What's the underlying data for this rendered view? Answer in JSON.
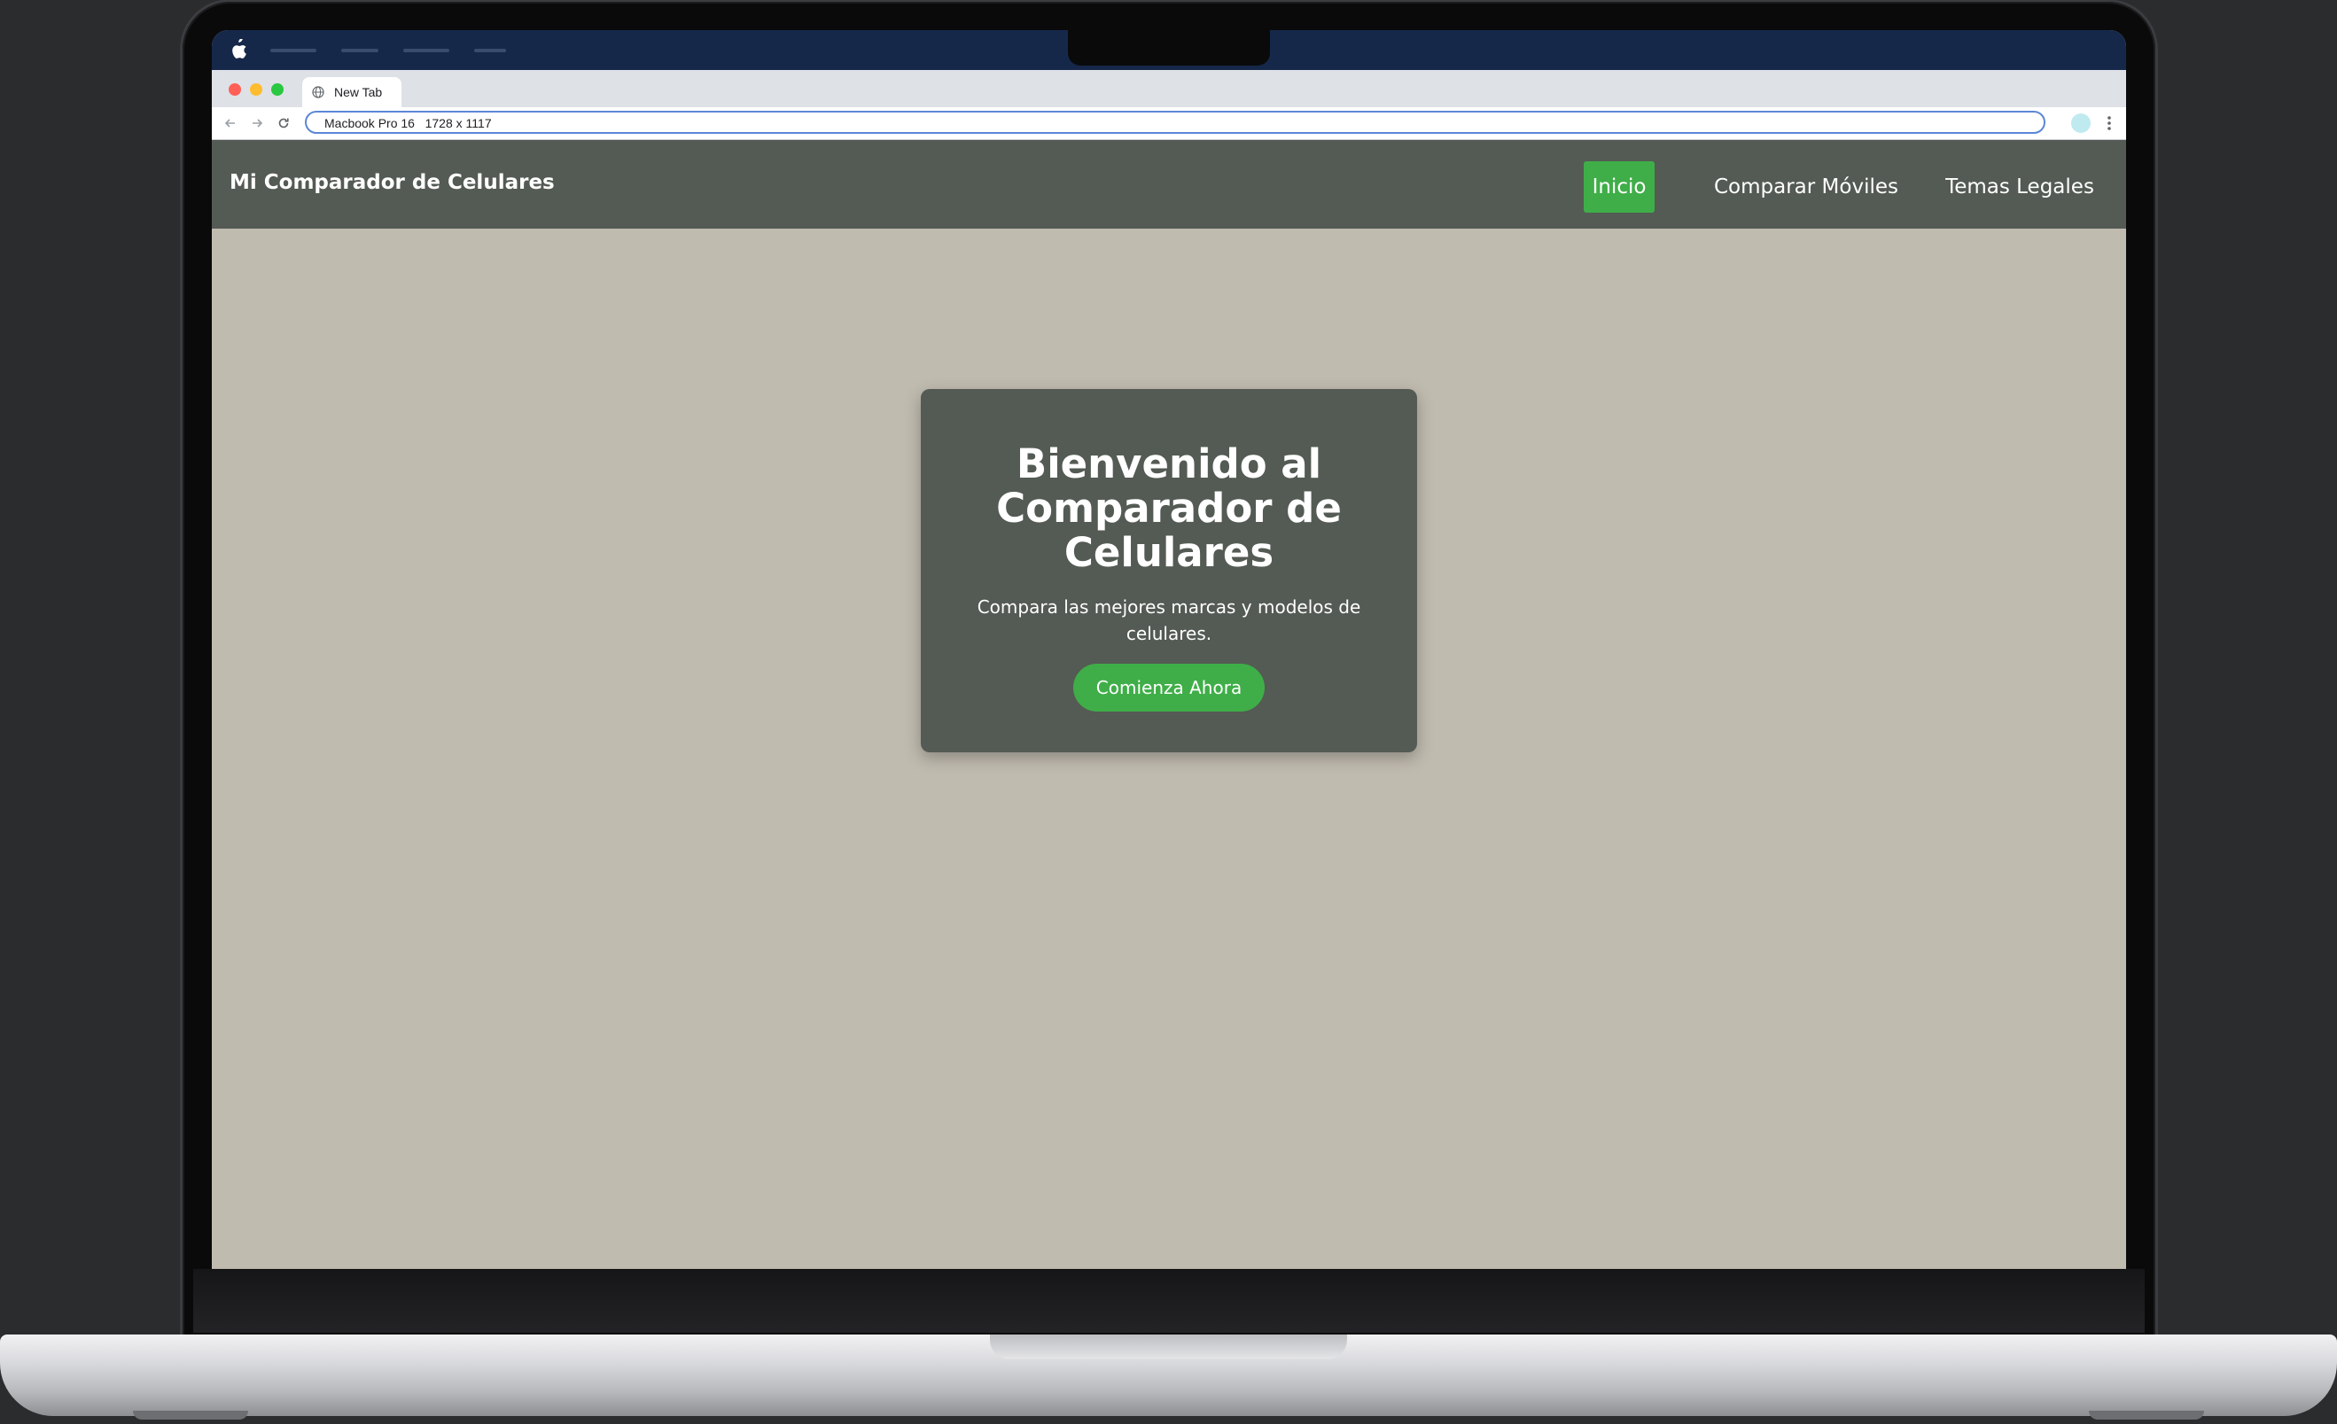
{
  "browser": {
    "tab_title": "New Tab",
    "address_bar": "Macbook Pro 16   1728 x 1117"
  },
  "site": {
    "brand": "Mi Comparador de Celulares",
    "nav": [
      {
        "label": "Inicio",
        "active": true
      },
      {
        "label": "Comparar Móviles",
        "active": false
      },
      {
        "label": "Temas Legales",
        "active": false
      }
    ]
  },
  "hero": {
    "title": "Bienvenido al Comparador de Celulares",
    "subtitle": "Compara las mejores marcas y modelos de celulares.",
    "cta_label": "Comienza Ahora"
  },
  "colors": {
    "nav_bg": "#545a54",
    "page_bg": "#c0bbaf",
    "accent": "#3fae48"
  },
  "icons": [
    "apple-icon",
    "globe-icon",
    "back-arrow-icon",
    "forward-arrow-icon",
    "reload-icon",
    "profile-icon",
    "kebab-menu-icon"
  ]
}
